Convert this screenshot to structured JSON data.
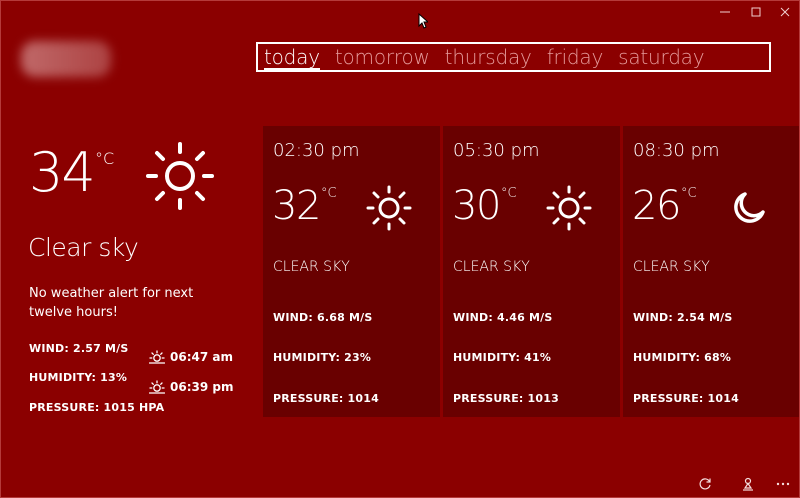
{
  "window": {
    "controls": {
      "minimize": "minimize",
      "maximize": "maximize",
      "close": "close"
    }
  },
  "location": {
    "name": "",
    "blurred": true
  },
  "tabs": [
    {
      "label": "today",
      "active": true
    },
    {
      "label": "tomorrow",
      "active": false
    },
    {
      "label": "thursday",
      "active": false
    },
    {
      "label": "friday",
      "active": false
    },
    {
      "label": "saturday",
      "active": false
    }
  ],
  "current": {
    "temperature": "34",
    "unit": "°C",
    "icon": "sun-icon",
    "summary": "Clear sky",
    "alert": "No weather alert for next twelve hours!",
    "wind": "WIND: 2.57 M/S",
    "humidity": "HUMIDITY: 13%",
    "pressure": "PRESSURE: 1015 HPA",
    "sunrise": "06:47 am",
    "sunset": "06:39 pm"
  },
  "forecast": [
    {
      "time": "02:30 pm",
      "temperature": "32",
      "unit": "°C",
      "icon": "sun-icon",
      "summary": "CLEAR SKY",
      "wind": "WIND: 6.68 M/S",
      "humidity": "HUMIDITY: 23%",
      "pressure": "PRESSURE: 1014"
    },
    {
      "time": "05:30 pm",
      "temperature": "30",
      "unit": "°C",
      "icon": "sun-icon",
      "summary": "CLEAR SKY",
      "wind": "WIND: 4.46 M/S",
      "humidity": "HUMIDITY: 41%",
      "pressure": "PRESSURE: 1013"
    },
    {
      "time": "08:30 pm",
      "temperature": "26",
      "unit": "°C",
      "icon": "moon-icon",
      "summary": "CLEAR SKY",
      "wind": "WIND: 2.54 M/S",
      "humidity": "HUMIDITY: 68%",
      "pressure": "PRESSURE: 1014"
    }
  ],
  "appbar": {
    "refresh_icon": "refresh-icon",
    "location_icon": "location-pin-icon",
    "more_icon": "more-icon"
  },
  "colors": {
    "background": "#8b0000",
    "card": "#690000",
    "inactive_tab": "#e59a9a",
    "text": "#ffffff"
  }
}
